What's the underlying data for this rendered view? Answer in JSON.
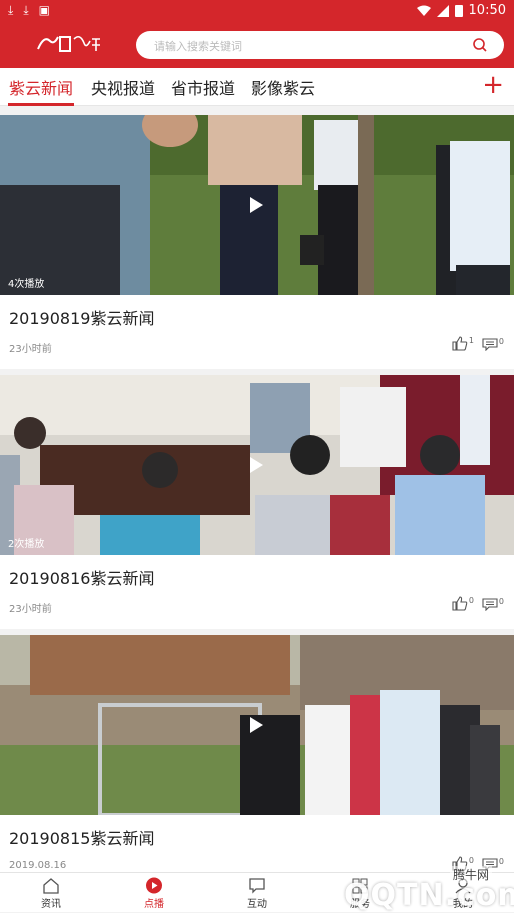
{
  "status_bar": {
    "time": "10:50"
  },
  "header": {
    "logo_text": "今日紫云",
    "search_placeholder": "请输入搜索关键词"
  },
  "tabs": [
    {
      "label": "紫云新闻",
      "active": true
    },
    {
      "label": "央视报道",
      "active": false
    },
    {
      "label": "省市报道",
      "active": false
    },
    {
      "label": "影像紫云",
      "active": false
    }
  ],
  "add_tab_label": "+",
  "videos": [
    {
      "title": "20190819紫云新闻",
      "time": "23小时前",
      "views": "4次播放",
      "likes": "1",
      "comments": "0"
    },
    {
      "title": "20190816紫云新闻",
      "time": "23小时前",
      "views": "2次播放",
      "likes": "0",
      "comments": "0"
    },
    {
      "title": "20190815紫云新闻",
      "time": "2019.08.16",
      "views": "",
      "likes": "0",
      "comments": "0"
    }
  ],
  "bottom_nav": [
    {
      "label": "资讯",
      "icon": "home-icon",
      "active": false
    },
    {
      "label": "点播",
      "icon": "play-circle-icon",
      "active": true
    },
    {
      "label": "互动",
      "icon": "chat-icon",
      "active": false
    },
    {
      "label": "服务",
      "icon": "grid-icon",
      "active": false
    },
    {
      "label": "我的",
      "icon": "user-icon",
      "active": false
    }
  ],
  "watermark": {
    "label": "腾牛网",
    "domain": "QQTN.com"
  },
  "colors": {
    "brand": "#d4262b"
  }
}
